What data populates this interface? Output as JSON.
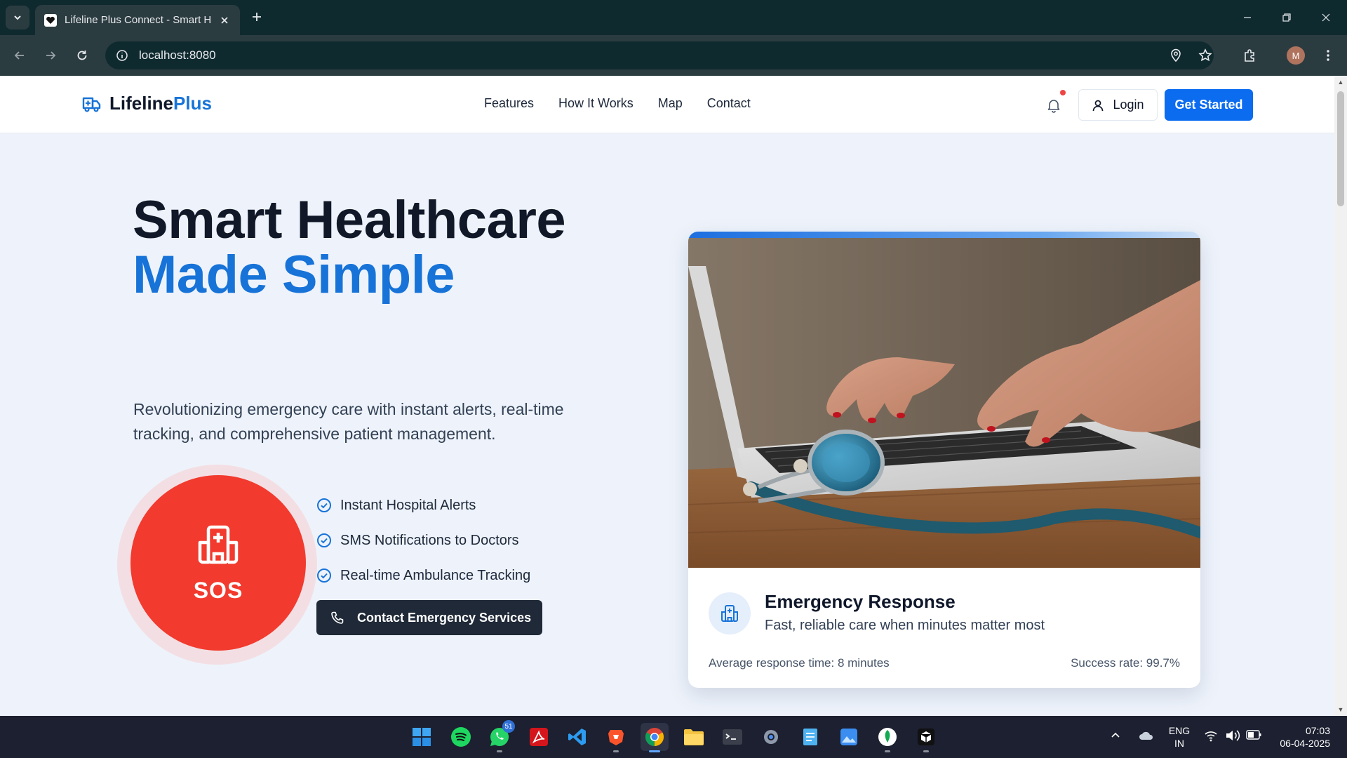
{
  "browser": {
    "tab_title": "Lifeline Plus Connect - Smart H",
    "url": "localhost:8080",
    "avatar_initial": "M"
  },
  "header": {
    "logo_main": "Lifeline",
    "logo_accent": "Plus",
    "nav": [
      "Features",
      "How It Works",
      "Map",
      "Contact"
    ],
    "login_label": "Login",
    "cta_label": "Get Started"
  },
  "hero": {
    "title_line1": "Smart Healthcare",
    "title_line2": "Made Simple",
    "subtitle": "Revolutionizing emergency care with instant alerts, real-time tracking, and comprehensive patient management.",
    "sos_label": "SOS",
    "features": [
      "Instant Hospital Alerts",
      "SMS Notifications to Doctors",
      "Real-time Ambulance Tracking"
    ],
    "contact_button": "Contact Emergency Services"
  },
  "card": {
    "title": "Emergency Response",
    "subtitle": "Fast, reliable care when minutes matter most",
    "stat_left": "Average response time: 8 minutes",
    "stat_right": "Success rate: 99.7%"
  },
  "taskbar": {
    "whatsapp_badge": "51",
    "lang_line1": "ENG",
    "lang_line2": "IN",
    "time": "07:03",
    "date": "06-04-2025"
  },
  "colors": {
    "brand_blue": "#1773d8",
    "cta_blue": "#0b6cf0",
    "sos_red": "#f23a2e",
    "dark_button": "#1f2937"
  }
}
